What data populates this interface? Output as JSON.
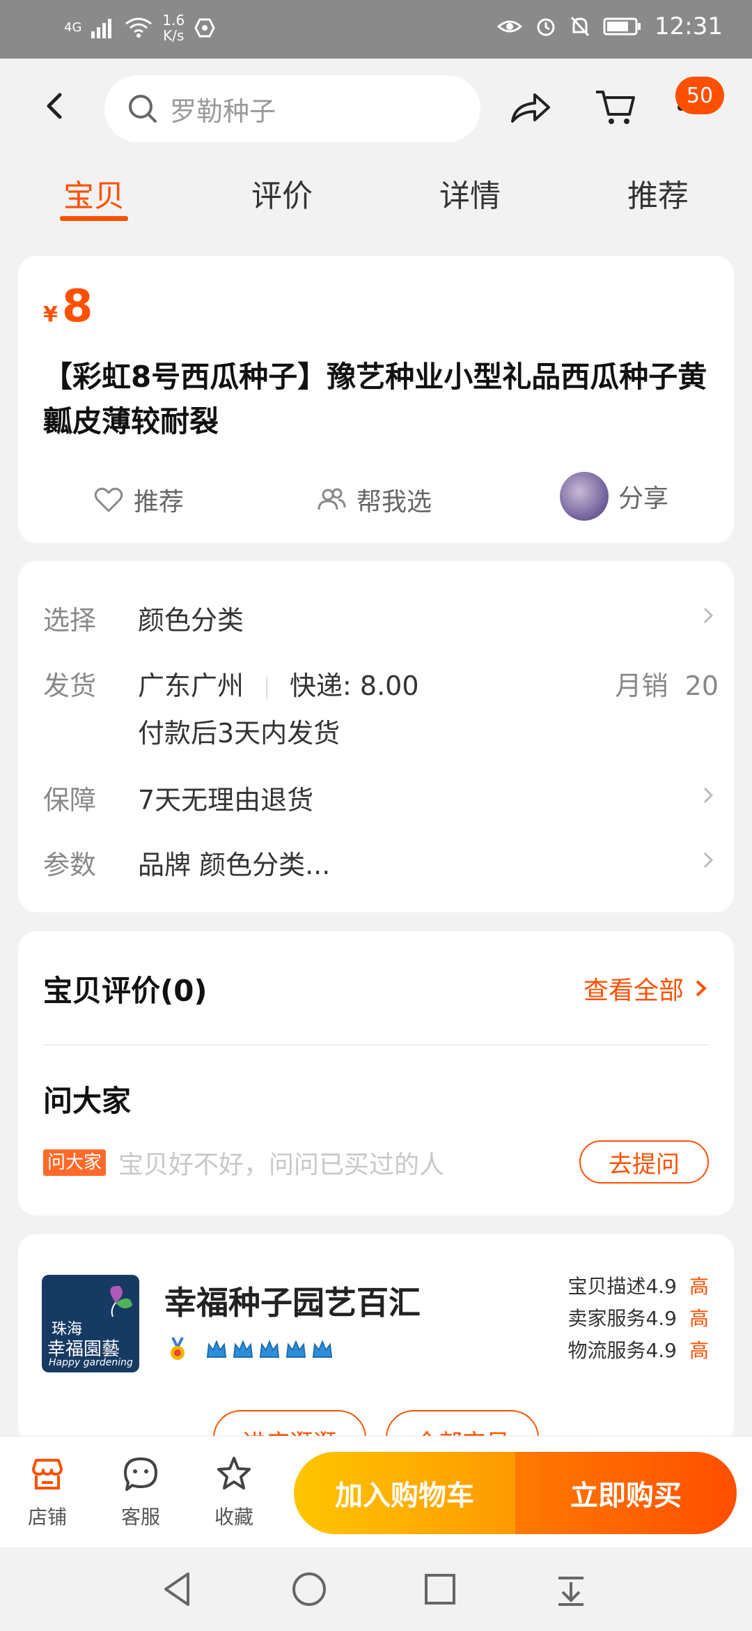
{
  "status_bar": {
    "network": "4G",
    "speed_value": "1.6",
    "speed_unit": "K/s",
    "time": "12:31"
  },
  "header": {
    "search_placeholder": "罗勒种子",
    "cart_badge": "50"
  },
  "tabs": [
    {
      "label": "宝贝",
      "active": true
    },
    {
      "label": "评价",
      "active": false
    },
    {
      "label": "详情",
      "active": false
    },
    {
      "label": "推荐",
      "active": false
    }
  ],
  "product": {
    "currency": "¥",
    "price": "8",
    "title": "【彩虹8号西瓜种子】豫艺种业小型礼品西瓜种子黄瓤皮薄较耐裂",
    "actions": {
      "recommend": "推荐",
      "help_choose": "帮我选",
      "share": "分享"
    }
  },
  "details": {
    "select_label": "选择",
    "select_value": "颜色分类",
    "ship_label": "发货",
    "ship_from": "广东广州",
    "ship_fee": "快递: 8.00",
    "monthly_label": "月销",
    "monthly_value": "20",
    "ship_time": "付款后3天内发货",
    "guarantee_label": "保障",
    "guarantee_value": "7天无理由退货",
    "params_label": "参数",
    "params_value": "品牌 颜色分类..."
  },
  "reviews": {
    "title": "宝贝评价(0)",
    "see_all": "查看全部",
    "ask_title": "问大家",
    "ask_tag": "问大家",
    "ask_placeholder": "宝贝好不好，问问已买过的人",
    "ask_button": "去提问"
  },
  "shop": {
    "logo_line1": "珠海",
    "logo_line2": "幸福園藝",
    "logo_en": "Happy gardening",
    "name": "幸福种子园艺百汇",
    "ratings": [
      {
        "label": "宝贝描述",
        "score": "4.9",
        "level": "高"
      },
      {
        "label": "卖家服务",
        "score": "4.9",
        "level": "高"
      },
      {
        "label": "物流服务",
        "score": "4.9",
        "level": "高"
      }
    ],
    "btn_enter": "进店逛逛",
    "btn_all": "全部宝贝"
  },
  "bottom_bar": {
    "store": "店铺",
    "service": "客服",
    "favorite": "收藏",
    "add_to_cart": "加入购物车",
    "buy_now": "立即购买"
  },
  "colors": {
    "accent": "#ff5000",
    "cart_gradient_start": "#ffc500",
    "buy_gradient_end": "#ff4e00"
  }
}
